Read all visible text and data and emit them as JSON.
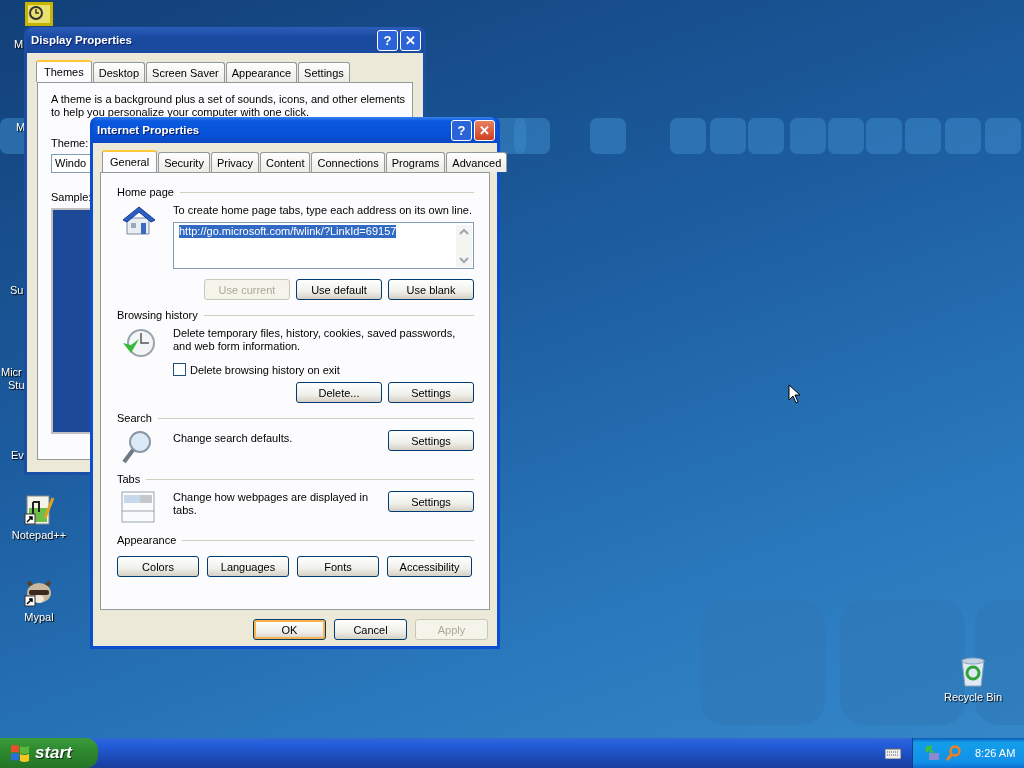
{
  "desktop": {
    "cut_labels": [
      {
        "text": "M"
      },
      {
        "text": "M"
      },
      {
        "text": "Su"
      },
      {
        "text": "Micr"
      },
      {
        "text": "Stu"
      },
      {
        "text": "Ev"
      }
    ],
    "icons": [
      {
        "label": "Notepad++",
        "kind": "notepad"
      },
      {
        "label": "Mypal",
        "kind": "raccoon"
      },
      {
        "label": "Recycle Bin",
        "kind": "recycle"
      }
    ]
  },
  "display_properties": {
    "title": "Display Properties",
    "active": false,
    "help": "?",
    "close": "✕",
    "tabs": [
      {
        "label": "Themes",
        "selected": true
      },
      {
        "label": "Desktop",
        "selected": false
      },
      {
        "label": "Screen Saver",
        "selected": false
      },
      {
        "label": "Appearance",
        "selected": false
      },
      {
        "label": "Settings",
        "selected": false
      }
    ],
    "description": "A theme is a background plus a set of sounds, icons, and other elements to help you personalize your computer with one click.",
    "theme_label": "Theme:",
    "theme_value": "Windo",
    "sample_label": "Sample:"
  },
  "internet_properties": {
    "title": "Internet Properties",
    "active": true,
    "help": "?",
    "close": "✕",
    "tabs": [
      {
        "label": "General",
        "selected": true
      },
      {
        "label": "Security",
        "selected": false
      },
      {
        "label": "Privacy",
        "selected": false
      },
      {
        "label": "Content",
        "selected": false
      },
      {
        "label": "Connections",
        "selected": false
      },
      {
        "label": "Programs",
        "selected": false
      },
      {
        "label": "Advanced",
        "selected": false
      }
    ],
    "sections": [
      {
        "heading": "Home page",
        "kind": "homepage",
        "text": "To create home page tabs, type each address on its own line.",
        "address": "http://go.microsoft.com/fwlink/?LinkId=69157",
        "buttons": [
          {
            "label": "Use current",
            "disabled": true
          },
          {
            "label": "Use default",
            "disabled": false
          },
          {
            "label": "Use blank",
            "disabled": false
          }
        ]
      },
      {
        "heading": "Browsing history",
        "kind": "history",
        "text": "Delete temporary files, history, cookies, saved passwords, and web form information.",
        "checkbox": {
          "label": "Delete browsing history on exit",
          "checked": false
        },
        "buttons": [
          {
            "label": "Delete...",
            "disabled": false
          },
          {
            "label": "Settings",
            "disabled": false
          }
        ]
      },
      {
        "heading": "Search",
        "kind": "search",
        "text": "Change search defaults.",
        "buttons": [
          {
            "label": "Settings",
            "disabled": false
          }
        ]
      },
      {
        "heading": "Tabs",
        "kind": "tabs",
        "text": "Change how webpages are displayed in tabs.",
        "buttons": [
          {
            "label": "Settings",
            "disabled": false
          }
        ]
      },
      {
        "heading": "Appearance",
        "kind": "appearance",
        "buttons": [
          {
            "label": "Colors",
            "disabled": false
          },
          {
            "label": "Languages",
            "disabled": false
          },
          {
            "label": "Fonts",
            "disabled": false
          },
          {
            "label": "Accessibility",
            "disabled": false
          }
        ]
      }
    ],
    "footer_buttons": [
      {
        "label": "OK",
        "default": true,
        "disabled": false
      },
      {
        "label": "Cancel",
        "default": false,
        "disabled": false
      },
      {
        "label": "Apply",
        "default": false,
        "disabled": true
      }
    ]
  },
  "taskbar": {
    "start": "start",
    "clock": "8:26 AM"
  }
}
